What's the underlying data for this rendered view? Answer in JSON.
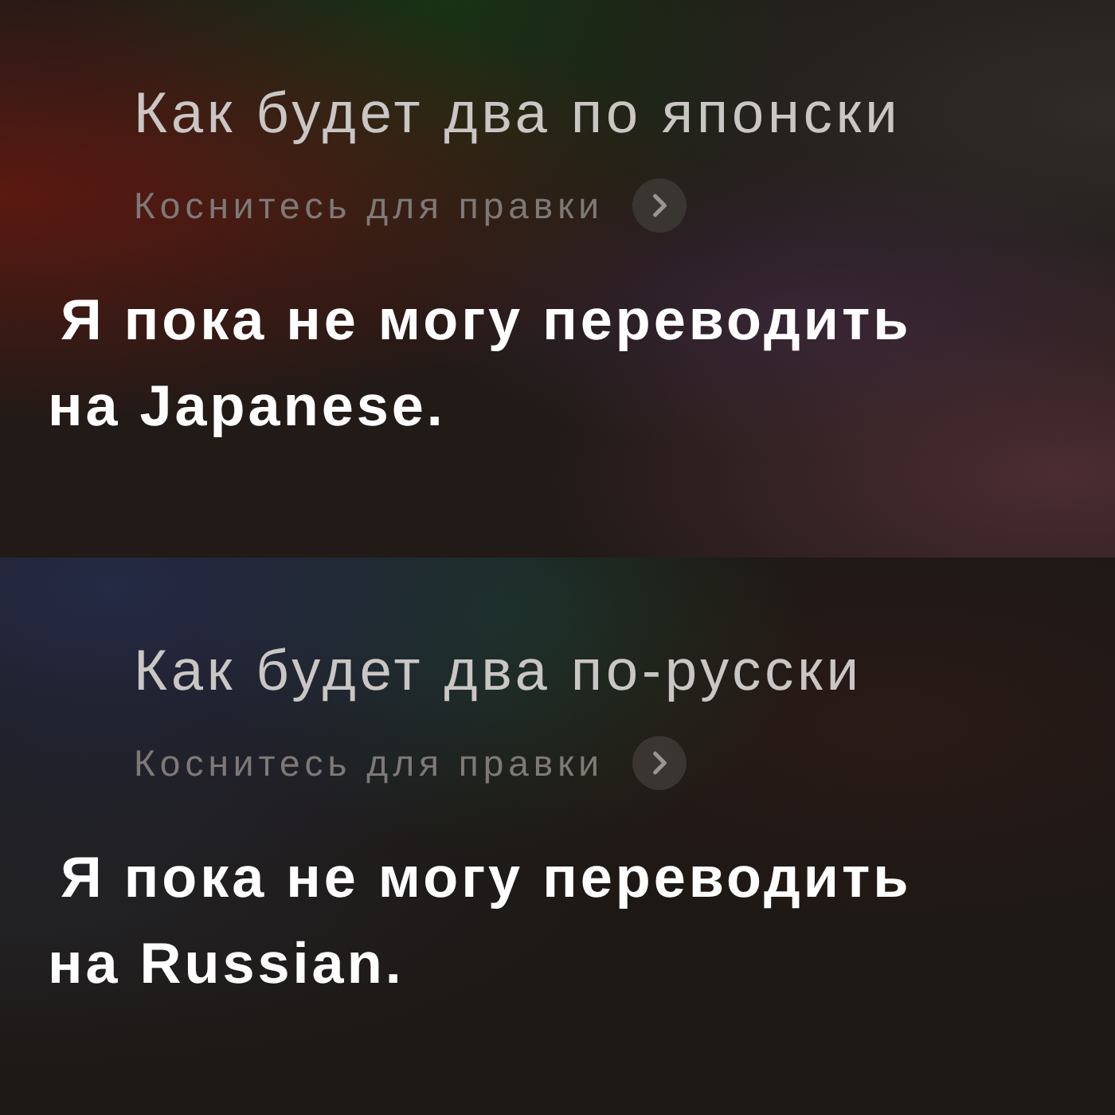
{
  "panels": [
    {
      "query": "Как будет два по японски",
      "edit_hint": "Коснитесь для правки",
      "response": "Я пока не могу переводить на Japanese."
    },
    {
      "query": "Как будет два по-русски",
      "edit_hint": "Коснитесь для правки",
      "response": "Я пока не могу переводить на Russian."
    }
  ]
}
